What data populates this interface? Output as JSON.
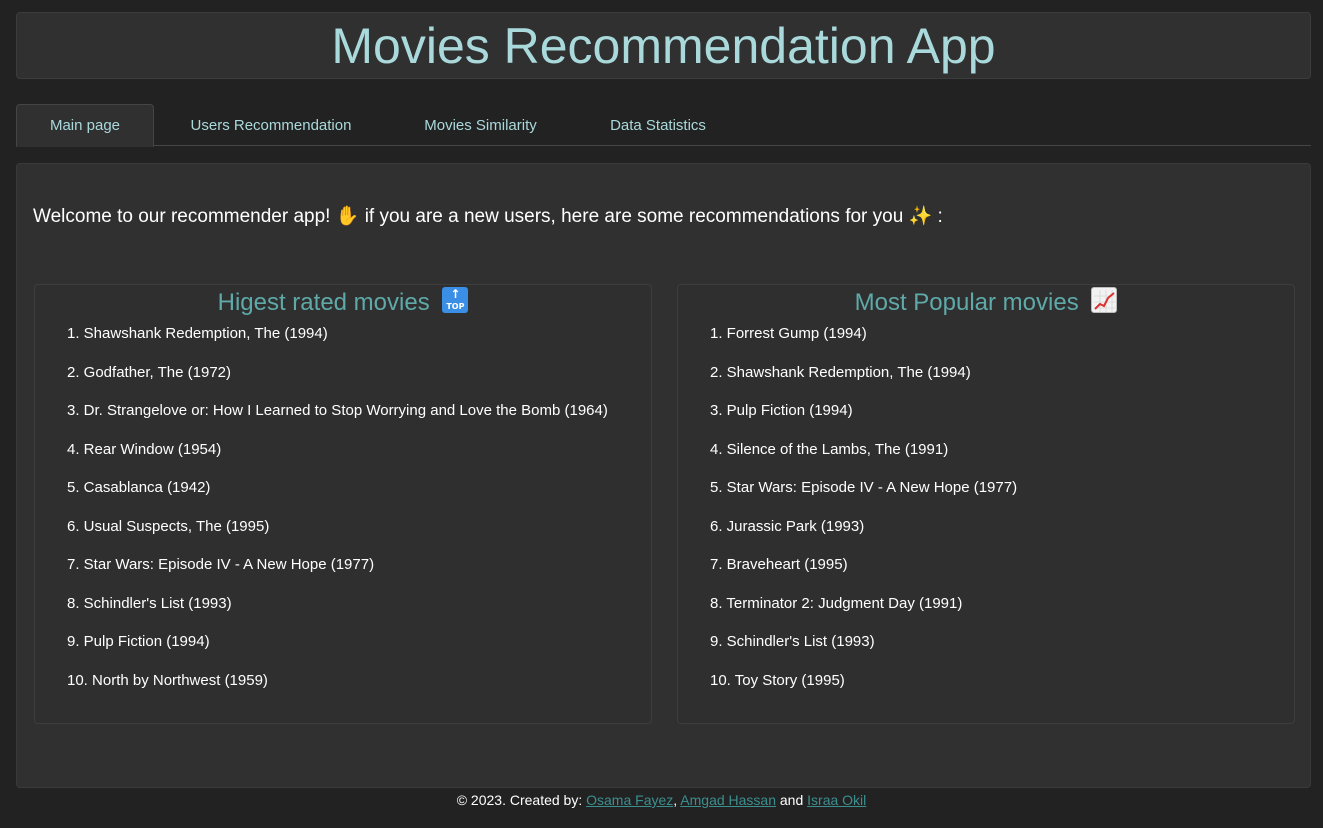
{
  "header": {
    "title": "Movies Recommendation App"
  },
  "tabs": [
    {
      "label": "Main page",
      "active": true
    },
    {
      "label": "Users Recommendation",
      "active": false
    },
    {
      "label": "Movies Similarity",
      "active": false
    },
    {
      "label": "Data Statistics",
      "active": false
    }
  ],
  "main": {
    "welcome_text_1": "Welcome to our recommender app!",
    "welcome_text_2": "if you are a new users, here are some recommendations for you",
    "welcome_end": ":",
    "wave_icon": "✋",
    "sparkle_icon": "✨",
    "highest_rated": {
      "title": "Higest rated movies",
      "icon": "top-arrow-icon",
      "badge_text": "TOP",
      "badge_arrow": "↑",
      "items": [
        "1. Shawshank Redemption, The (1994)",
        "2. Godfather, The (1972)",
        "3. Dr. Strangelove or: How I Learned to Stop Worrying and Love the Bomb (1964)",
        "4. Rear Window (1954)",
        "5. Casablanca (1942)",
        "6. Usual Suspects, The (1995)",
        "7. Star Wars: Episode IV - A New Hope (1977)",
        "8. Schindler's List (1993)",
        "9. Pulp Fiction (1994)",
        "10. North by Northwest (1959)"
      ]
    },
    "most_popular": {
      "title": "Most Popular movies",
      "icon": "chart-increasing-icon",
      "items": [
        "1. Forrest Gump (1994)",
        "2. Shawshank Redemption, The (1994)",
        "3. Pulp Fiction (1994)",
        "4. Silence of the Lambs, The (1991)",
        "5. Star Wars: Episode IV - A New Hope (1977)",
        "6. Jurassic Park (1993)",
        "7. Braveheart (1995)",
        "8. Terminator 2: Judgment Day (1991)",
        "9. Schindler's List (1993)",
        "10. Toy Story (1995)"
      ]
    }
  },
  "footer": {
    "prefix": "© 2023. Created by:",
    "author1": "Osama Fayez",
    "sep1": ",",
    "author2": "Amgad Hassan",
    "and": "and",
    "author3": "Israa Okil"
  },
  "colors": {
    "background": "#222222",
    "panel": "#303030",
    "title": "#aad9dc",
    "section_title": "#5fa9a9",
    "link": "#3d8f8f"
  }
}
